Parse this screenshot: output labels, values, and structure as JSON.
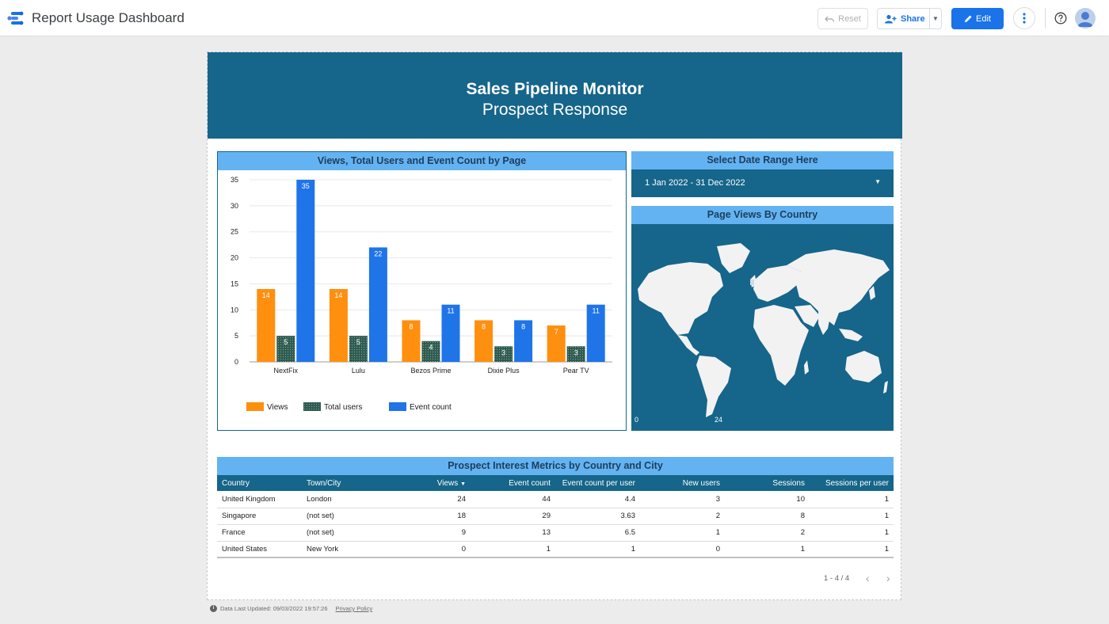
{
  "app": {
    "title": "Report Usage Dashboard",
    "reset_label": "Reset",
    "share_label": "Share",
    "edit_label": "Edit"
  },
  "icons": [
    "data-studio-logo-icon",
    "undo-icon",
    "add-person-icon",
    "caret-down-icon",
    "pencil-icon",
    "more-vert-icon",
    "help-icon",
    "user-avatar-icon"
  ],
  "colors": {
    "header": "#16658a",
    "panel_title": "#63b3f2",
    "views": "#ff8f0e",
    "total_users": "#2f5a50",
    "event_count": "#1f74e8",
    "edit_button": "#1a73e8"
  },
  "report": {
    "title": "Sales Pipeline Monitor",
    "subtitle": "Prospect Response"
  },
  "chart_panel": {
    "title": "Views, Total Users and Event Count by Page"
  },
  "date_panel": {
    "title": "Select Date Range Here",
    "value": "1 Jan 2022 - 31 Dec 2022"
  },
  "map_panel": {
    "title": "Page Views By Country",
    "legend_min": "0",
    "legend_max": "24"
  },
  "chart_data": {
    "type": "bar",
    "categories": [
      "NextFix",
      "Lulu",
      "Bezos Prime",
      "Dixie Plus",
      "Pear TV"
    ],
    "series": [
      {
        "name": "Views",
        "color": "#ff8f0e",
        "pattern": "solid",
        "values": [
          14,
          14,
          8,
          8,
          7
        ]
      },
      {
        "name": "Total users",
        "color": "#2f5a50",
        "pattern": "dotted",
        "values": [
          5,
          5,
          4,
          3,
          3
        ]
      },
      {
        "name": "Event count",
        "color": "#1f74e8",
        "pattern": "solid",
        "values": [
          35,
          22,
          11,
          8,
          11
        ]
      }
    ],
    "ylim": [
      0,
      35
    ],
    "yticks": [
      0,
      5,
      10,
      15,
      20,
      25,
      30,
      35
    ],
    "data_labels": true,
    "legend": "bottom",
    "grid": true
  },
  "table": {
    "title": "Prospect Interest Metrics by Country and City",
    "columns": [
      "Country",
      "Town/City",
      "Views",
      "Event count",
      "Event count per user",
      "New users",
      "Sessions",
      "Sessions per user"
    ],
    "sorted_column": "Views",
    "sort_indicator": "▼",
    "rows": [
      [
        "United Kingdom",
        "London",
        "24",
        "44",
        "4.4",
        "3",
        "10",
        "1"
      ],
      [
        "Singapore",
        "(not set)",
        "18",
        "29",
        "3.63",
        "2",
        "8",
        "1"
      ],
      [
        "France",
        "(not set)",
        "9",
        "13",
        "6.5",
        "1",
        "2",
        "1"
      ],
      [
        "United States",
        "New York",
        "0",
        "1",
        "1",
        "0",
        "1",
        "1"
      ]
    ],
    "pagination": "1 - 4 / 4"
  },
  "footer": {
    "updated": "Data Last Updated: 09/03/2022 19:57:26",
    "privacy": "Privacy Policy"
  }
}
